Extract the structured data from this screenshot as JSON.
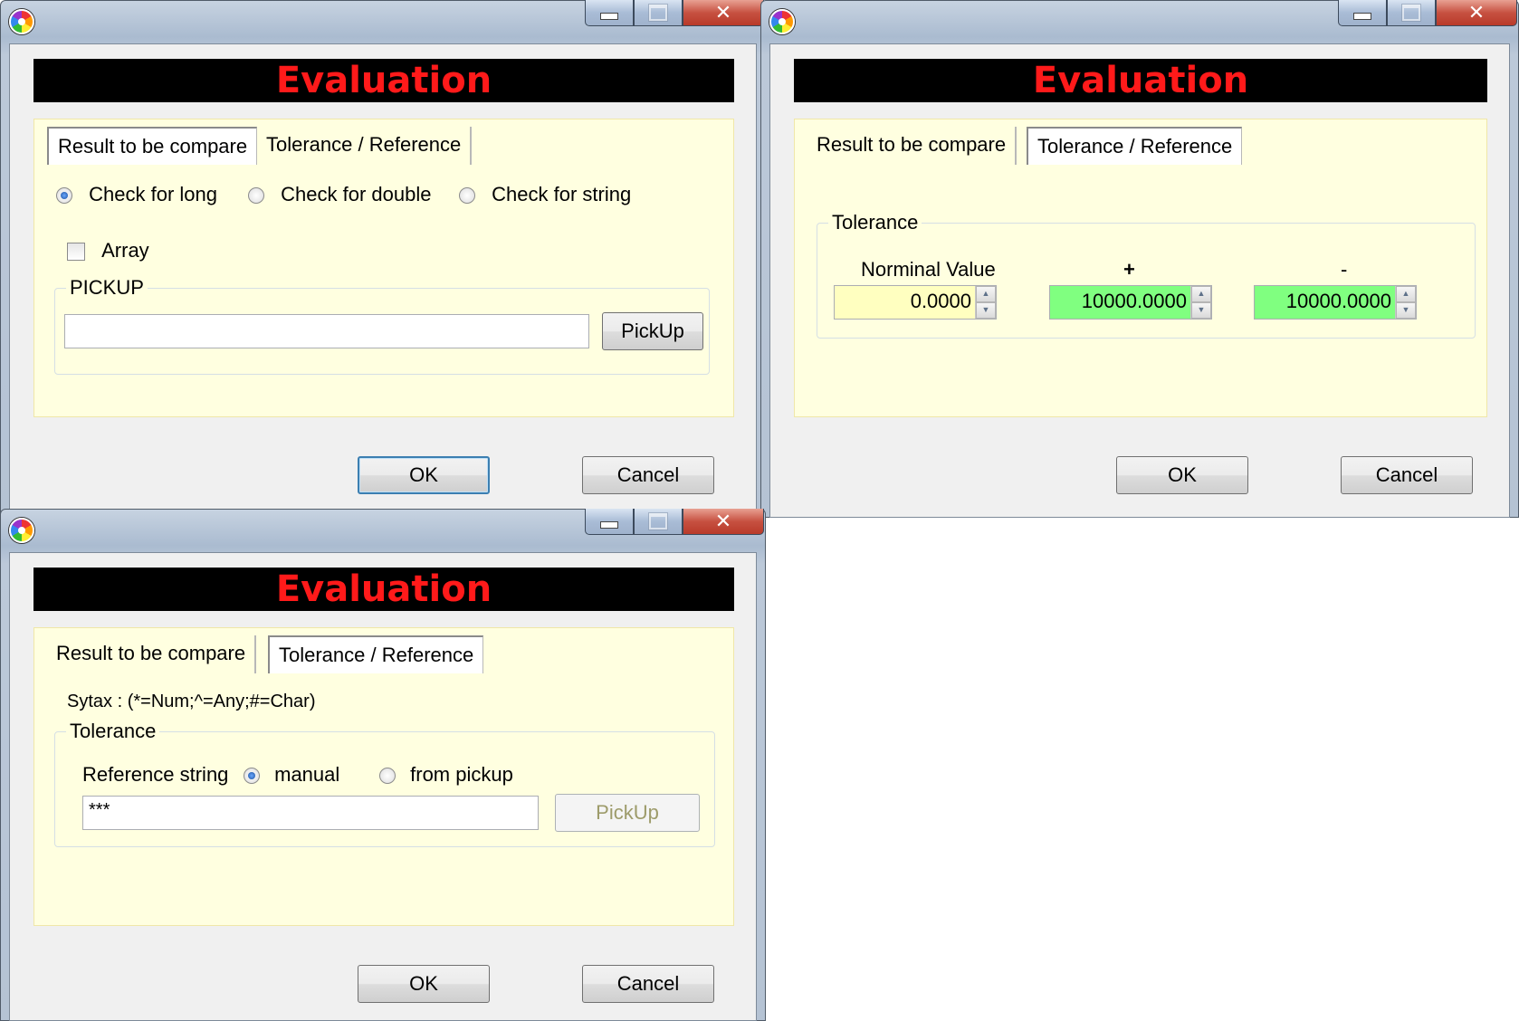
{
  "windows": [
    {
      "banner": "Evaluation",
      "tabs": [
        "Result to be compare",
        "Tolerance / Reference"
      ],
      "check_types": [
        "Check for long",
        "Check for double",
        "Check for string"
      ],
      "selected_check": "Check for long",
      "array_label": "Array",
      "array_checked": false,
      "pickup_group": "PICKUP",
      "pickup_value": "",
      "pickup_button": "PickUp",
      "ok": "OK",
      "cancel": "Cancel"
    },
    {
      "banner": "Evaluation",
      "tabs": [
        "Result to be compare",
        "Tolerance / Reference"
      ],
      "tolerance_group": "Tolerance",
      "nominal_label": "Norminal Value",
      "plus_label": "+",
      "minus_label": "-",
      "nominal_value": "0.0000",
      "plus_value": "10000.0000",
      "minus_value": "10000.0000",
      "ok": "OK",
      "cancel": "Cancel"
    },
    {
      "banner": "Evaluation",
      "tabs": [
        "Result to be compare",
        "Tolerance / Reference"
      ],
      "syntax_text": "Sytax : (*=Num;^=Any;#=Char)",
      "tolerance_group": "Tolerance",
      "reference_label": "Reference string",
      "radio_manual": "manual",
      "radio_pickup": "from pickup",
      "reference_value": "***",
      "pickup_button": "PickUp",
      "ok": "OK",
      "cancel": "Cancel"
    }
  ],
  "colors": {
    "banner_bg": "#000000",
    "banner_text": "#ff1a1a",
    "panel_bg": "#ffffe0",
    "nominal_field": "#ffffc0",
    "tolerance_field": "#80ff80"
  },
  "icons": {
    "app": "app-logo-icon",
    "minimize": "minimize-icon",
    "maximize": "maximize-icon",
    "close": "close-icon",
    "spin": "spin-arrows-icon"
  }
}
